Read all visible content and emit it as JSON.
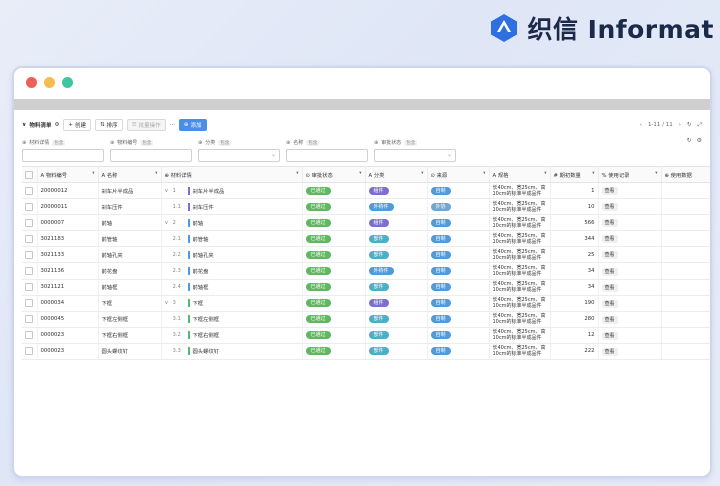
{
  "brand": {
    "name": "织信 Informat"
  },
  "toolbar": {
    "title": "物料清单",
    "create": "创建",
    "sort": "排序",
    "batch": "批量操作",
    "more": "···",
    "add": "添加",
    "pagination": "1-11 / 11"
  },
  "filters": [
    {
      "label": "材料详情",
      "tag": "包含",
      "type": "text"
    },
    {
      "label": "物料编号",
      "tag": "包含",
      "type": "text"
    },
    {
      "label": "分类",
      "tag": "包含",
      "type": "select"
    },
    {
      "label": "名称",
      "tag": "包含",
      "type": "text"
    },
    {
      "label": "审批状态",
      "tag": "包含",
      "type": "select"
    }
  ],
  "columns": [
    "物料编号",
    "名称",
    "材料详情",
    "审批状态",
    "分类",
    "来源",
    "规格",
    "期初数量",
    "使用记录",
    "使用数据"
  ],
  "rows": [
    {
      "code": "20000012",
      "name": "刹车片半成品",
      "level": "1",
      "chevron": "∨",
      "detail": "刹车片半成品",
      "bar": "purple",
      "status": "已通过",
      "category": "组件",
      "catColor": "purple",
      "source": "自制",
      "srcColor": "blue",
      "spec": "长40cm、宽25cm、高10cm的标准半成品件",
      "qty": "1",
      "record": "查看"
    },
    {
      "code": "20000011",
      "name": "刹车压件",
      "level": "1.1",
      "chevron": "",
      "detail": "刹车压件",
      "bar": "purple",
      "status": "已通过",
      "category": "外购件",
      "catColor": "blue",
      "source": "外协",
      "srcColor": "orange",
      "spec": "长40cm、宽25cm、高10cm的标准半成品件",
      "qty": "10",
      "record": "查看"
    },
    {
      "code": "0000007",
      "name": "前轴",
      "level": "2",
      "chevron": "∨",
      "detail": "前轴",
      "bar": "blue",
      "status": "已通过",
      "category": "组件",
      "catColor": "purple",
      "source": "自制",
      "srcColor": "blue",
      "spec": "长40cm、宽25cm、高10cm的标准半成品件",
      "qty": "566",
      "record": "查看"
    },
    {
      "code": "3021183",
      "name": "前管轴",
      "level": "2.1",
      "chevron": "",
      "detail": "前管轴",
      "bar": "blue",
      "status": "已通过",
      "category": "部件",
      "catColor": "teal",
      "source": "自制",
      "srcColor": "blue",
      "spec": "长40cm、宽25cm、高10cm的标准半成品件",
      "qty": "344",
      "record": "查看"
    },
    {
      "code": "3021133",
      "name": "前轴孔夹",
      "level": "2.2",
      "chevron": "",
      "detail": "前轴孔夹",
      "bar": "blue",
      "status": "已通过",
      "category": "部件",
      "catColor": "teal",
      "source": "自制",
      "srcColor": "blue",
      "spec": "长40cm、宽25cm、高10cm的标准半成品件",
      "qty": "25",
      "record": "查看"
    },
    {
      "code": "3021136",
      "name": "前花盘",
      "level": "2.3",
      "chevron": "",
      "detail": "前花盘",
      "bar": "blue",
      "status": "已通过",
      "category": "外购件",
      "catColor": "blue",
      "source": "自制",
      "srcColor": "blue",
      "spec": "长40cm、宽25cm、高10cm的标准半成品件",
      "qty": "34",
      "record": "查看"
    },
    {
      "code": "3021121",
      "name": "前轴框",
      "level": "2.4",
      "chevron": "",
      "detail": "前轴框",
      "bar": "blue",
      "status": "已通过",
      "category": "部件",
      "catColor": "teal",
      "source": "自制",
      "srcColor": "blue",
      "spec": "长40cm、宽25cm、高10cm的标准半成品件",
      "qty": "34",
      "record": "查看"
    },
    {
      "code": "0000034",
      "name": "下框",
      "level": "3",
      "chevron": "∨",
      "detail": "下框",
      "bar": "green",
      "status": "已通过",
      "category": "组件",
      "catColor": "purple",
      "source": "自制",
      "srcColor": "blue",
      "spec": "长40cm、宽25cm、高10cm的标准半成品件",
      "qty": "190",
      "record": "查看"
    },
    {
      "code": "0000045",
      "name": "下框左侧框",
      "level": "3.1",
      "chevron": "",
      "detail": "下框左侧框",
      "bar": "green",
      "status": "已通过",
      "category": "部件",
      "catColor": "teal",
      "source": "自制",
      "srcColor": "blue",
      "spec": "长40cm、宽25cm、高10cm的标准半成品件",
      "qty": "280",
      "record": "查看"
    },
    {
      "code": "0000023",
      "name": "下框右侧框",
      "level": "3.2",
      "chevron": "",
      "detail": "下框右侧框",
      "bar": "green",
      "status": "已通过",
      "category": "部件",
      "catColor": "teal",
      "source": "自制",
      "srcColor": "blue",
      "spec": "长40cm、宽25cm、高10cm的标准半成品件",
      "qty": "12",
      "record": "查看"
    },
    {
      "code": "0000023",
      "name": "圆头螺纹钉",
      "level": "3.3",
      "chevron": "",
      "detail": "圆头螺纹钉",
      "bar": "green",
      "status": "已通过",
      "category": "部件",
      "catColor": "teal",
      "source": "自制",
      "srcColor": "blue",
      "spec": "长40cm、宽25cm、高10cm的标准半成品件",
      "qty": "222",
      "record": "查看"
    }
  ]
}
